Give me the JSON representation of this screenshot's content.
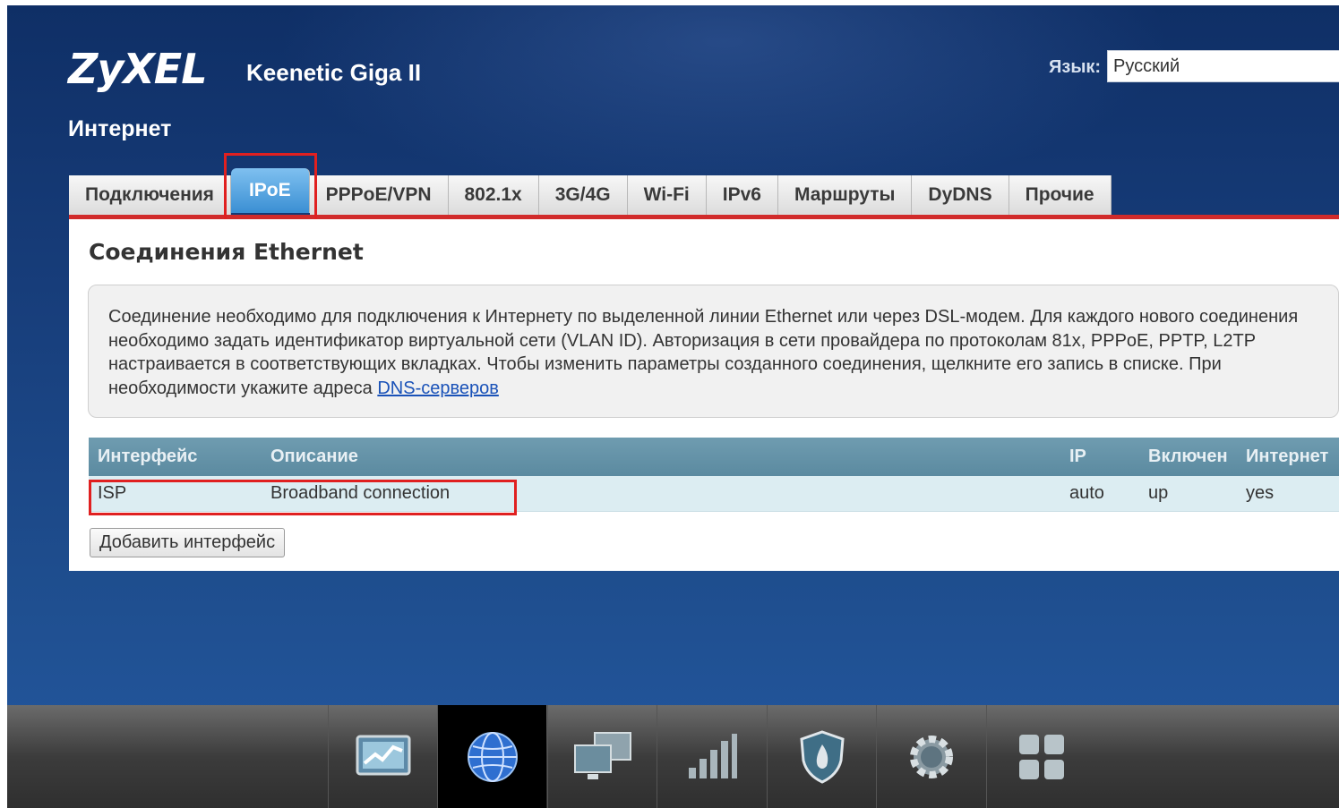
{
  "header": {
    "brand": "ZyXEL",
    "model": "Keenetic Giga II",
    "page_title": "Интернет",
    "language_label": "Язык:",
    "language_value": "Русский"
  },
  "tabs": [
    {
      "label": "Подключения",
      "active": false
    },
    {
      "label": "IPoE",
      "active": true
    },
    {
      "label": "PPPoE/VPN",
      "active": false
    },
    {
      "label": "802.1x",
      "active": false
    },
    {
      "label": "3G/4G",
      "active": false
    },
    {
      "label": "Wi-Fi",
      "active": false
    },
    {
      "label": "IPv6",
      "active": false
    },
    {
      "label": "Маршруты",
      "active": false
    },
    {
      "label": "DyDNS",
      "active": false
    },
    {
      "label": "Прочие",
      "active": false
    }
  ],
  "section": {
    "title": "Соединения Ethernet",
    "info_text": "Соединение необходимо для подключения к Интернету по выделенной линии Ethernet или через DSL-модем. Для каждого нового соединения необходимо задать идентификатор виртуальной сети (VLAN ID). Авторизация в сети провайдера по протоколам 81х, PPPoE, PPTP, L2TP настраивается в соответствующих вкладках. Чтобы изменить параметры созданного соединения, щелкните его запись в списке. При необходимости укажите адреса ",
    "info_link": "DNS-серверов"
  },
  "table": {
    "columns": [
      "Интерфейс",
      "Описание",
      "IP",
      "Включен",
      "Интернет"
    ],
    "rows": [
      {
        "interface": "ISP",
        "description": "Broadband connection",
        "ip": "auto",
        "enabled": "up",
        "internet": "yes"
      }
    ]
  },
  "buttons": {
    "add_interface": "Добавить интерфейс"
  },
  "dock": [
    {
      "icon": "monitor-chart-icon",
      "active": false
    },
    {
      "icon": "globe-icon",
      "active": true
    },
    {
      "icon": "computers-icon",
      "active": false
    },
    {
      "icon": "signal-bars-icon",
      "active": false
    },
    {
      "icon": "shield-icon",
      "active": false
    },
    {
      "icon": "gear-icon",
      "active": false
    },
    {
      "icon": "apps-grid-icon",
      "active": false
    }
  ],
  "colors": {
    "accent_red": "#d12b2b",
    "active_tab_blue": "#3a8fd3",
    "background_blue": "#173d7a",
    "table_header": "#5b8aa0",
    "link": "#1a52b8"
  }
}
